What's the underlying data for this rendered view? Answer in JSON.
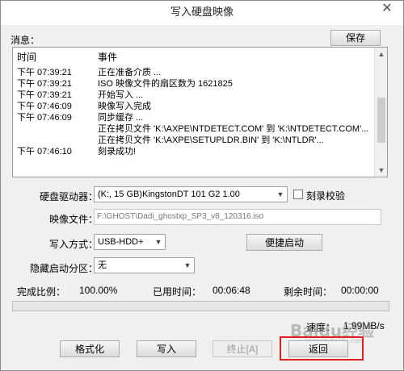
{
  "window": {
    "title": "写入硬盘映像",
    "close_glyph": "✕"
  },
  "messages": {
    "label": "消息：",
    "save_label": "保存",
    "columns": {
      "time": "时间",
      "event": "事件"
    },
    "rows": [
      {
        "time": "下午 07:39:21",
        "event": "正在准备介质 ..."
      },
      {
        "time": "下午 07:39:21",
        "event": "ISO 映像文件的扇区数为 1621825"
      },
      {
        "time": "下午 07:39:21",
        "event": "开始写入 ..."
      },
      {
        "time": "下午 07:46:09",
        "event": "映像写入完成"
      },
      {
        "time": "下午 07:46:09",
        "event": "同步缓存 ..."
      },
      {
        "time": "",
        "event": "正在拷贝文件 'K:\\AXPE\\NTDETECT.COM' 到 'K:\\NTDETECT.COM'..."
      },
      {
        "time": "",
        "event": "正在拷贝文件 'K:\\AXPE\\SETUPLDR.BIN' 到 'K:\\NTLDR'..."
      },
      {
        "time": "下午 07:46:10",
        "event": "刻录成功!"
      }
    ],
    "scroll_up_icon": "▲",
    "scroll_down_icon": "▼"
  },
  "drive": {
    "label": "硬盘驱动器：",
    "value": "(K:, 15 GB)KingstonDT 101 G2        1.00",
    "verify_label": "刻录校验",
    "verify_checked": false
  },
  "image": {
    "label": "映像文件：",
    "value": "F:\\GHOST\\Dadi_ghostxp_SP3_v8_120316.iso"
  },
  "write_mode": {
    "label": "写入方式：",
    "value": "USB-HDD+",
    "quick_boot_label": "便捷启动"
  },
  "hidden_partition": {
    "label": "隐藏启动分区：",
    "value": "无"
  },
  "stats": {
    "complete_label": "完成比例：",
    "complete_value": "100.00%",
    "elapsed_label": "已用时间：",
    "elapsed_value": "00:06:48",
    "remaining_label": "剩余时间：",
    "remaining_value": "00:00:00",
    "progress_percent": 100
  },
  "speed": {
    "label": "速度：",
    "value": "1.99MB/s"
  },
  "buttons": {
    "format": "格式化",
    "write": "写入",
    "abort": "终止[A]",
    "back": "返回"
  },
  "watermark": {
    "text": "Baidu经验",
    "sub": "jingyan.baidu.com"
  },
  "colors": {
    "window_bg": "#f0f0f0",
    "highlight": "#e02020"
  }
}
